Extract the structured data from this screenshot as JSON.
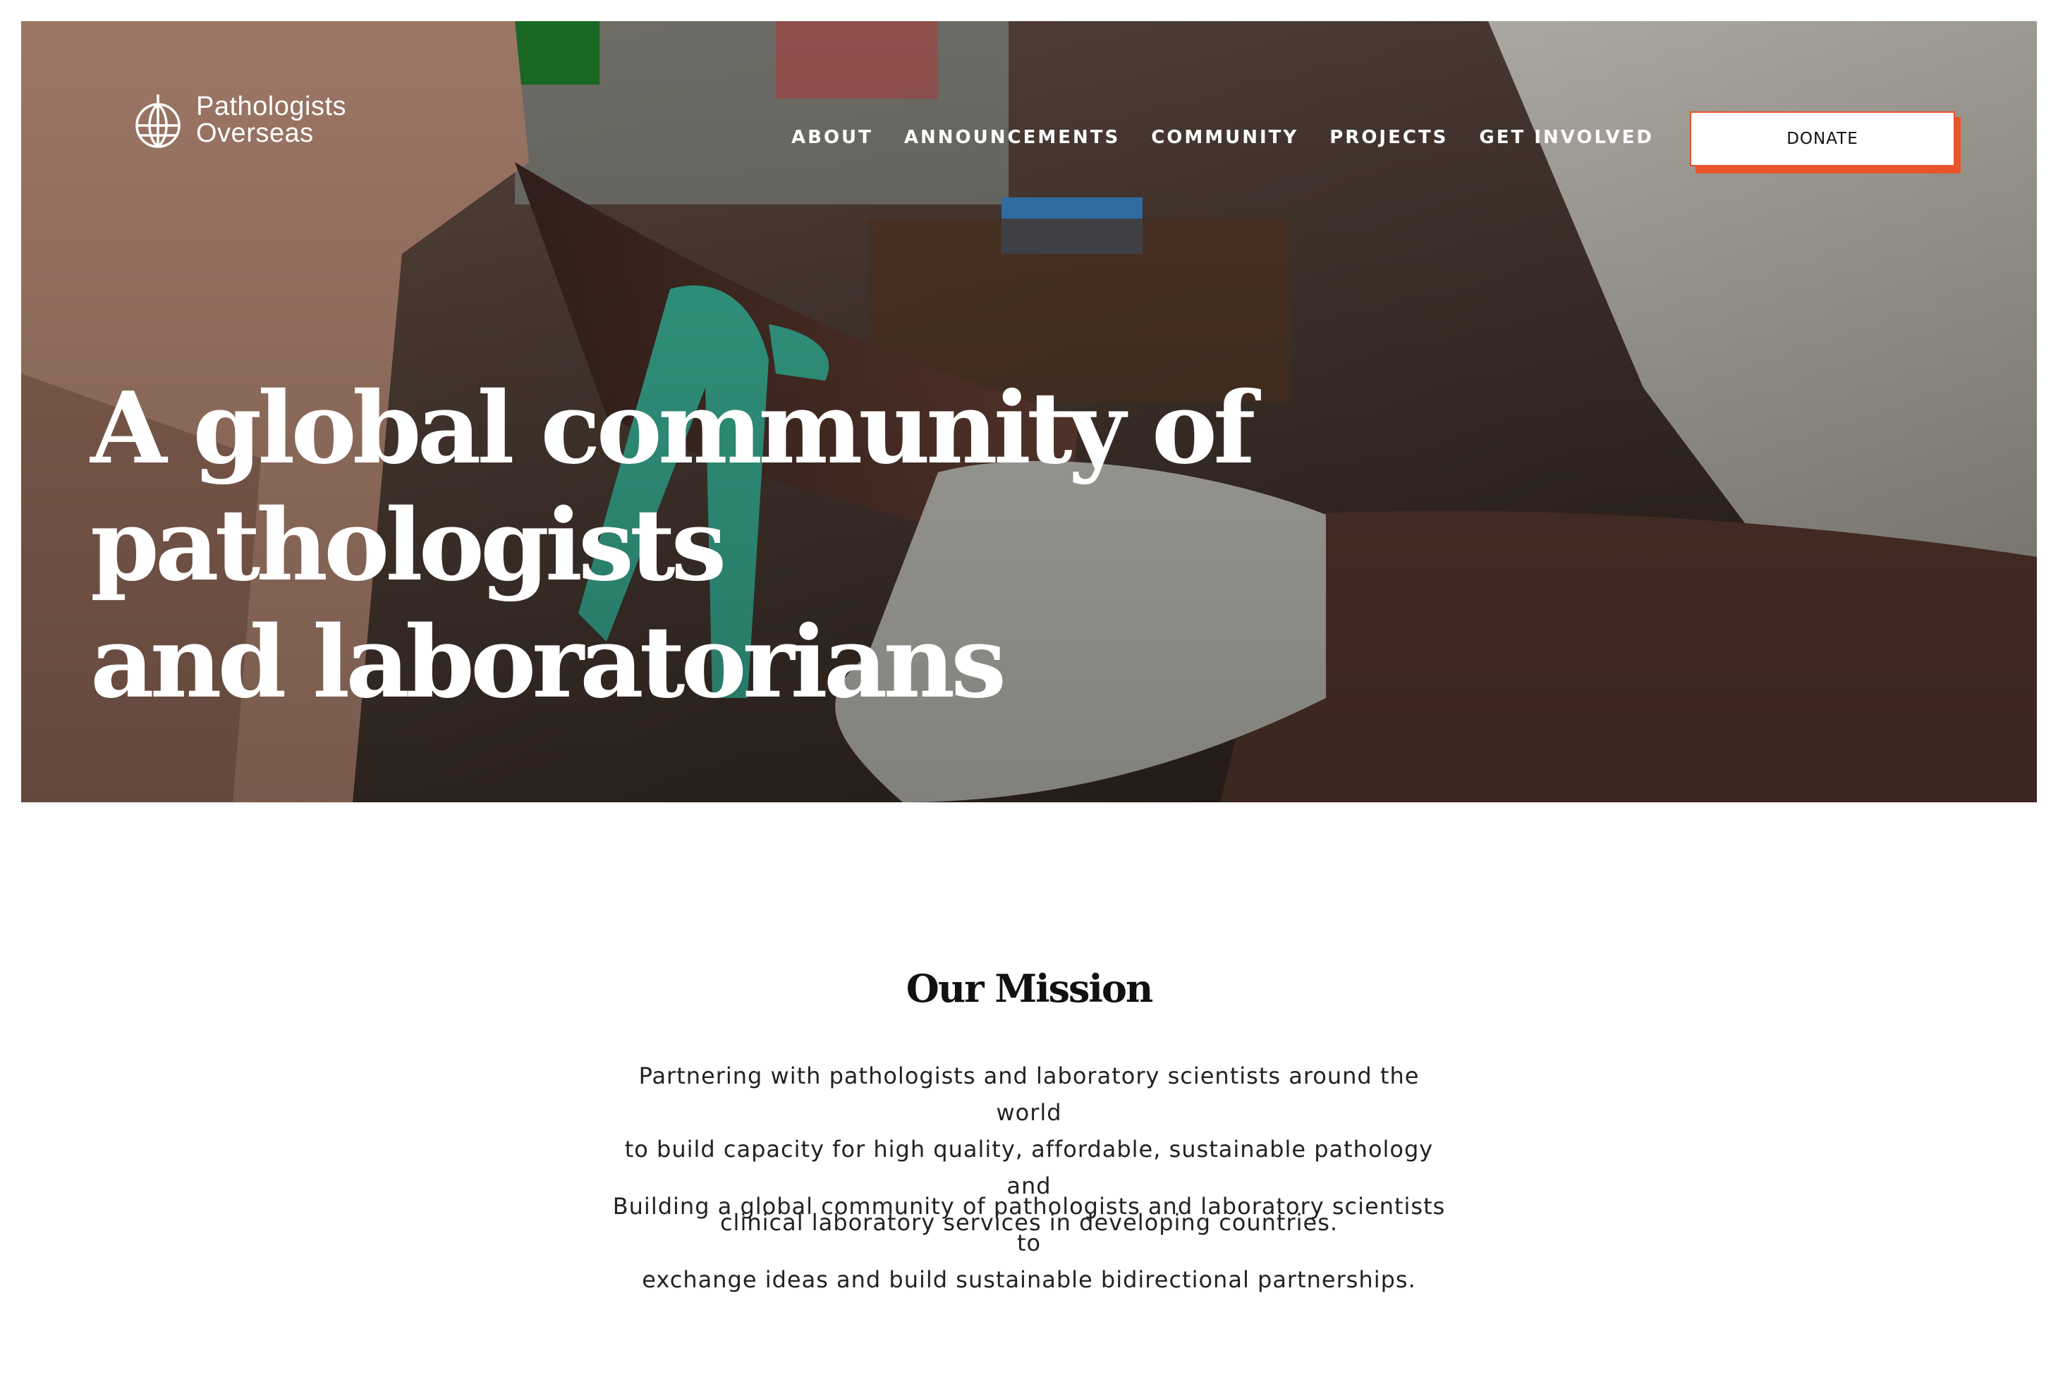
{
  "brand": {
    "name_line1": "Pathologists",
    "name_line2": "Overseas",
    "accent_color": "#e8542c"
  },
  "nav": {
    "items": [
      {
        "label": "ABOUT"
      },
      {
        "label": "ANNOUNCEMENTS"
      },
      {
        "label": "COMMUNITY"
      },
      {
        "label": "PROJECTS"
      },
      {
        "label": "GET INVOLVED"
      }
    ],
    "donate_label": "DONATE"
  },
  "hero": {
    "title_line1": "A global community of pathologists",
    "title_line2": "and laboratorians"
  },
  "mission": {
    "title": "Our Mission",
    "paragraph1_line1": "Partnering with pathologists and laboratory scientists around the world",
    "paragraph1_line2": "to build capacity for high quality, affordable, sustainable pathology and",
    "paragraph1_line3": "clinical laboratory services in developing countries.",
    "paragraph2_line1": "Building a global community of pathologists and laboratory scientists to",
    "paragraph2_line2": "exchange ideas and build sustainable bidirectional partnerships."
  }
}
